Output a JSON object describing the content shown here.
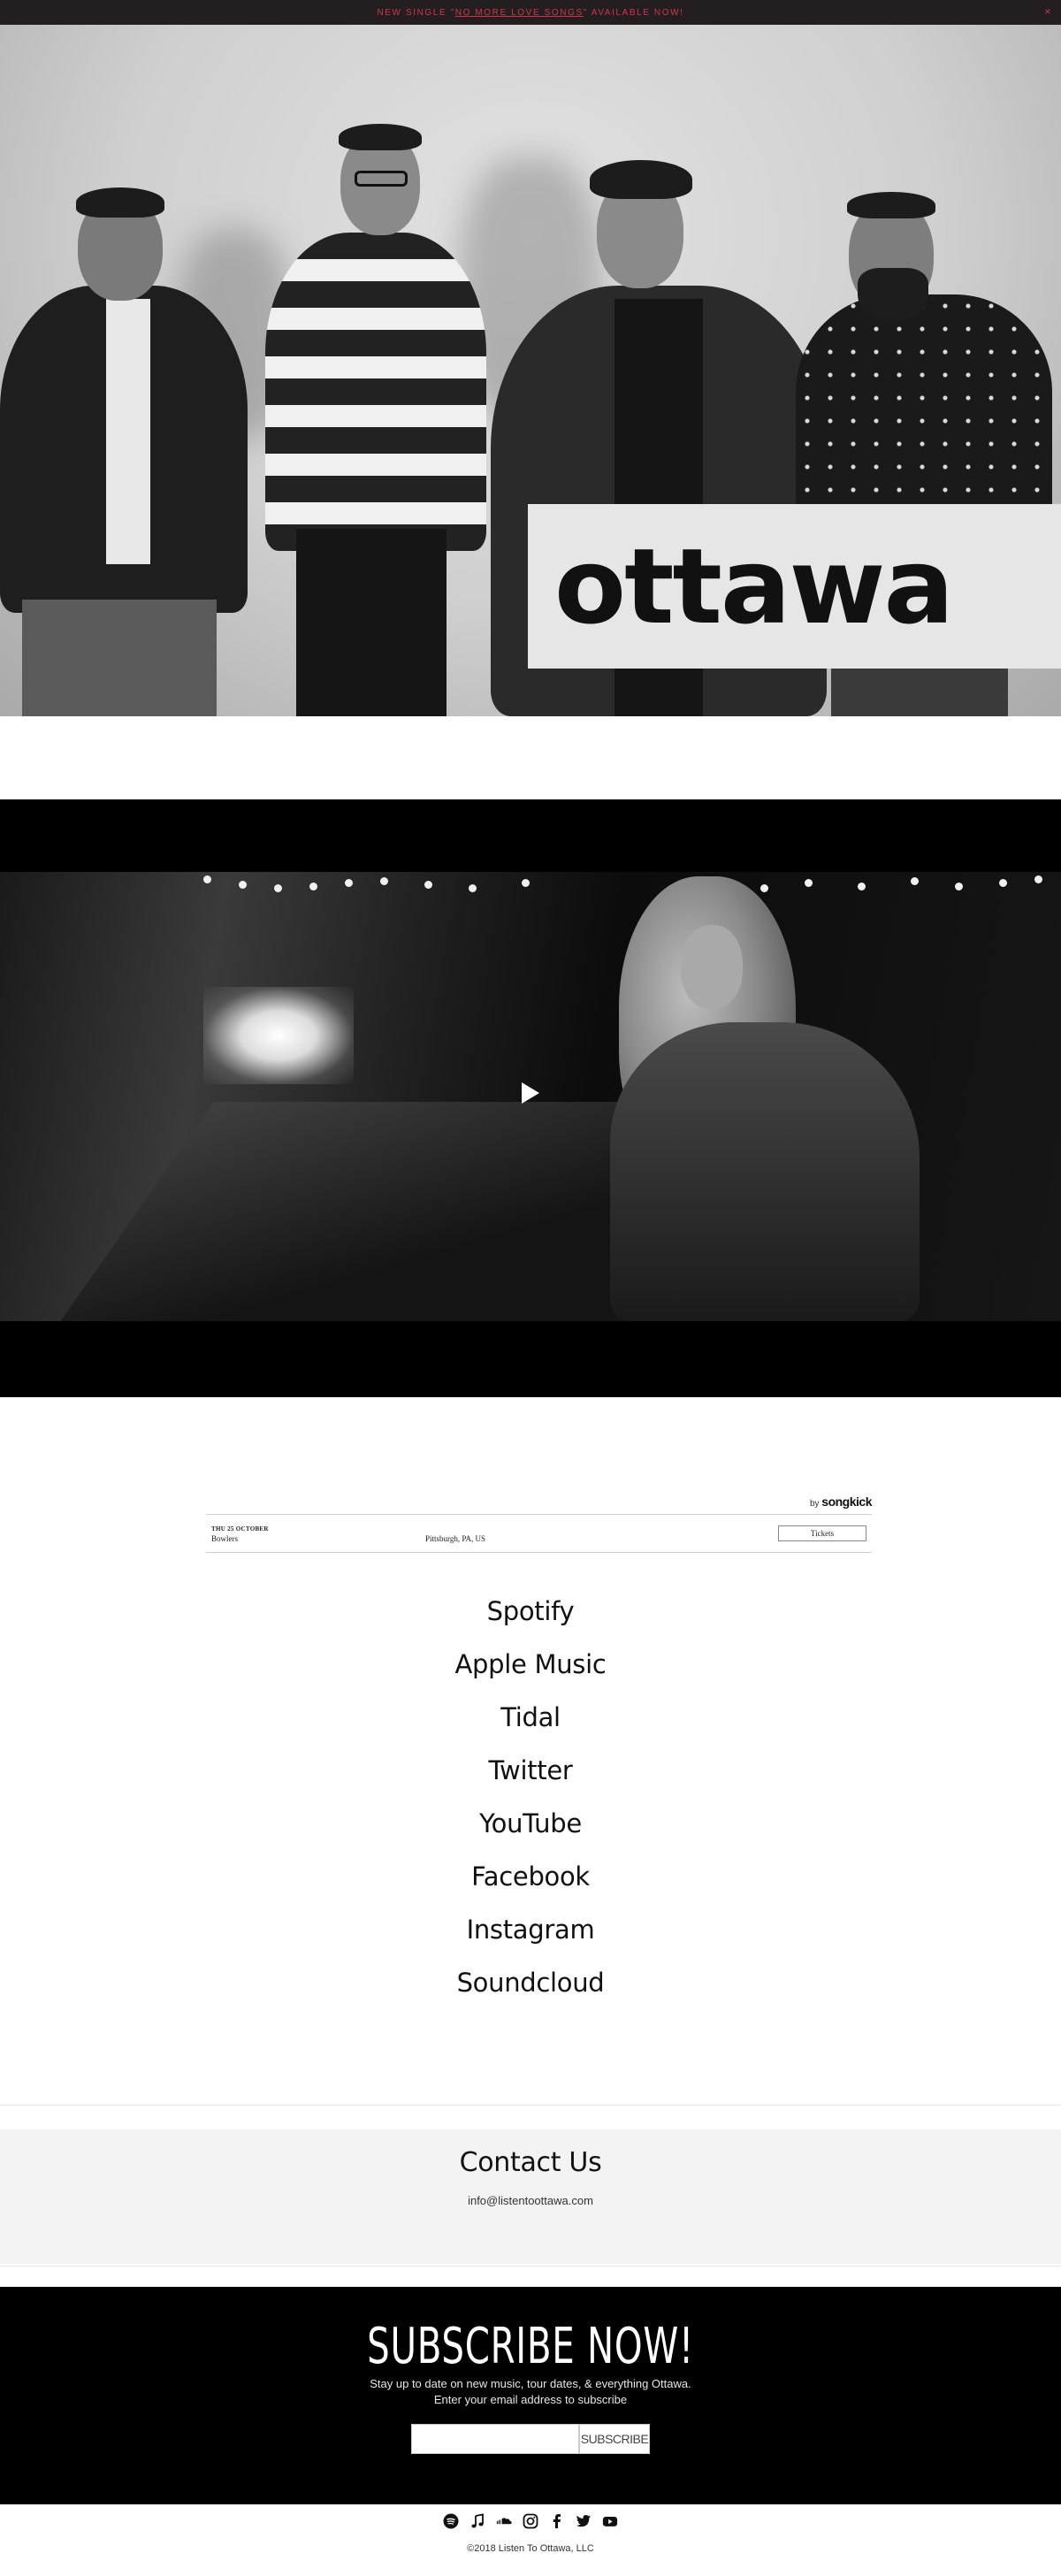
{
  "announcement": {
    "prefix": "NEW SINGLE \"",
    "link_text": "NO MORE LOVE SONGS",
    "suffix": "\" AVAILABLE NOW!",
    "close_glyph": "×"
  },
  "hero": {
    "logo_text": "ottawa"
  },
  "video": {
    "play_label": "play-icon"
  },
  "songkick": {
    "brand_by": "by",
    "brand_name": "songkick",
    "event": {
      "date": "THU 25 OCTOBER",
      "venue": "Bowlers",
      "location": "Pittsburgh, PA, US",
      "tickets_label": "Tickets"
    }
  },
  "links": [
    {
      "label": "Spotify"
    },
    {
      "label": "Apple Music"
    },
    {
      "label": "Tidal"
    },
    {
      "label": "Twitter"
    },
    {
      "label": "YouTube"
    },
    {
      "label": "Facebook"
    },
    {
      "label": "Instagram"
    },
    {
      "label": "Soundcloud"
    }
  ],
  "contact": {
    "title": "Contact Us",
    "email": "info@listentoottawa.com"
  },
  "subscribe": {
    "title": "SUBSCRIBE NOW!",
    "line1": "Stay up to date on new music, tour dates, & everything Ottawa.",
    "line2": "Enter your email address to subscribe",
    "input_placeholder": "",
    "button_label": "SUBSCRIBE"
  },
  "footer": {
    "social_icons": [
      "spotify-icon",
      "apple-music-icon",
      "soundcloud-icon",
      "instagram-icon",
      "facebook-icon",
      "twitter-icon",
      "youtube-icon"
    ],
    "copyright": "©2018 Listen To Ottawa, LLC"
  }
}
